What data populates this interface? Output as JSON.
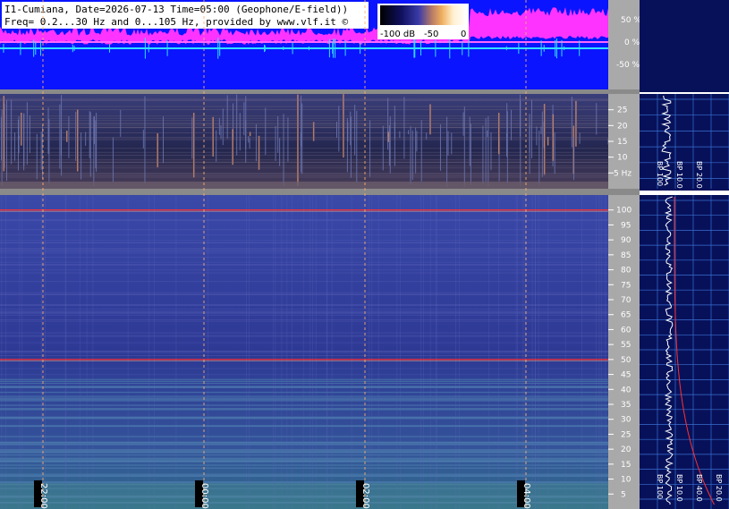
{
  "title": {
    "line1": "I1-Cumiana, Date=2026-07-13 Time=05:00 (Geophone/E-field))",
    "line2": "Freq= 0.2...30 Hz and 0...105 Hz, provided by www.vlf.it ©"
  },
  "colorbar": {
    "labels": [
      "-100 dB",
      "-50",
      "0"
    ]
  },
  "colors": {
    "amplitude_bg": "#0a14ff",
    "amplitude_trace": "#ff33ff",
    "filtered_trace": "#33e0ff",
    "spectro_bg": "#2b3588",
    "side_bg": "#07115a",
    "axis_bg": "#a9a9a9",
    "mains_line": "#ff3030"
  },
  "chart_data": [
    {
      "type": "line",
      "panel": "amplitude",
      "y_ticks": [
        "50 %",
        "0 %",
        "-50 %"
      ]
    },
    {
      "type": "heatmap",
      "panel": "spectrogram-low",
      "y_ticks": [
        "25",
        "20",
        "15",
        "10",
        "5 Hz"
      ],
      "ylim": [
        0,
        30
      ],
      "side_labels": [
        "BP 100",
        "BP 10.0",
        "BP 20.0"
      ]
    },
    {
      "type": "heatmap",
      "panel": "spectrogram-high",
      "y_ticks": [
        "100",
        "95",
        "90",
        "85",
        "80",
        "75",
        "70",
        "65",
        "60",
        "55",
        "50",
        "45",
        "40",
        "35",
        "30",
        "25",
        "20",
        "15",
        "10",
        "5"
      ],
      "ylim": [
        0,
        105
      ],
      "x_ticks": [
        "22:00",
        "00:00",
        "02:00",
        "04:00"
      ],
      "side_labels": [
        "BP 100",
        "BP 10.0",
        "BP 40.0",
        "BP 20.0"
      ],
      "mains_hz": [
        50,
        100
      ]
    }
  ]
}
